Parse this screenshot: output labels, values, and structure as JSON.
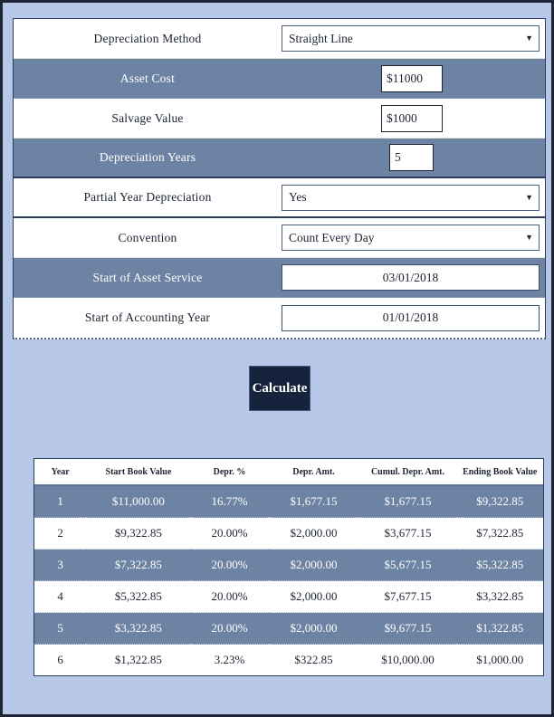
{
  "theme": {
    "page_bg": "#b6c7e8",
    "stripe": "#6d83a3",
    "border": "#2b3c5c",
    "button_bg": "#16233c"
  },
  "form": {
    "rows": [
      {
        "label": "Depreciation Method",
        "control": "select",
        "value": "Straight Line"
      },
      {
        "label": "Asset Cost",
        "control": "text",
        "value": "$11000"
      },
      {
        "label": "Salvage Value",
        "control": "text",
        "value": "$1000"
      },
      {
        "label": "Depreciation Years",
        "control": "number",
        "value": "5"
      },
      {
        "label": "Partial Year Depreciation",
        "control": "select",
        "value": "Yes"
      },
      {
        "label": "Convention",
        "control": "select",
        "value": "Count Every Day"
      },
      {
        "label": "Start of Asset Service",
        "control": "date",
        "value": "03/01/2018"
      },
      {
        "label": "Start of Accounting Year",
        "control": "date",
        "value": "01/01/2018"
      }
    ],
    "caret_glyph": "▼"
  },
  "actions": {
    "calculate_label": "Calculate"
  },
  "results": {
    "columns": [
      "Year",
      "Start Book Value",
      "Depr. %",
      "Depr. Amt.",
      "Cumul. Depr. Amt.",
      "Ending Book Value"
    ],
    "rows": [
      [
        "1",
        "$11,000.00",
        "16.77%",
        "$1,677.15",
        "$1,677.15",
        "$9,322.85"
      ],
      [
        "2",
        "$9,322.85",
        "20.00%",
        "$2,000.00",
        "$3,677.15",
        "$7,322.85"
      ],
      [
        "3",
        "$7,322.85",
        "20.00%",
        "$2,000.00",
        "$5,677.15",
        "$5,322.85"
      ],
      [
        "4",
        "$5,322.85",
        "20.00%",
        "$2,000.00",
        "$7,677.15",
        "$3,322.85"
      ],
      [
        "5",
        "$3,322.85",
        "20.00%",
        "$2,000.00",
        "$9,677.15",
        "$1,322.85"
      ],
      [
        "6",
        "$1,322.85",
        "3.23%",
        "$322.85",
        "$10,000.00",
        "$1,000.00"
      ]
    ]
  }
}
